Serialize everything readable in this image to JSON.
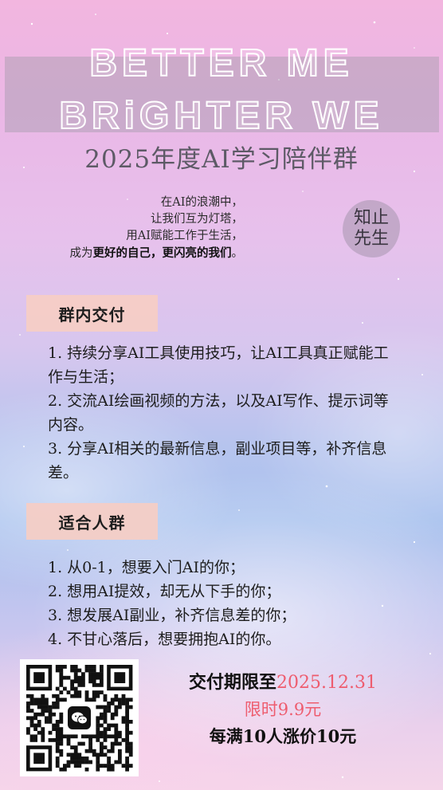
{
  "hero": {
    "line1": "BETTER ME",
    "line2": "BRiGHTER WE"
  },
  "title": "2025年度AI学习陪伴群",
  "poem": {
    "line1": "在AI的浪潮中，",
    "line2": "让我们互为灯塔，",
    "line3": "用AI赋能工作于生活，",
    "line4_prefix": "成为",
    "line4_emphasis": "更好的自己，更闪亮的我们",
    "line4_suffix": "。"
  },
  "seal": {
    "line1": "知止",
    "line2": "先生"
  },
  "deliverables": {
    "heading": "群内交付",
    "items": [
      "1. 持续分享AI工具使用技巧，让AI工具真正赋能工作与生活；",
      "2. 交流AI绘画视频的方法，以及AI写作、提示词等内容。",
      "3. 分享AI相关的最新信息，副业项目等，补齐信息差。"
    ]
  },
  "audience": {
    "heading": "适合人群",
    "items": [
      "1. 从0-1，想要入门AI的你；",
      "2. 想用AI提效，却无从下手的你；",
      "3. 想发展AI副业，补齐信息差的你；",
      "4. 不甘心落后，想要拥抱AI的你。"
    ]
  },
  "offer": {
    "deadline_label": "交付期限至",
    "deadline_date": "2025.12.31",
    "price": "限时9.9元",
    "rule": "每满10人涨价10元"
  },
  "qr": {
    "icon": "wechat-icon"
  },
  "colors": {
    "accent_red": "#ee5c6e",
    "tag_bg": "#f6cdc4",
    "title_gray": "#5d5a66"
  }
}
